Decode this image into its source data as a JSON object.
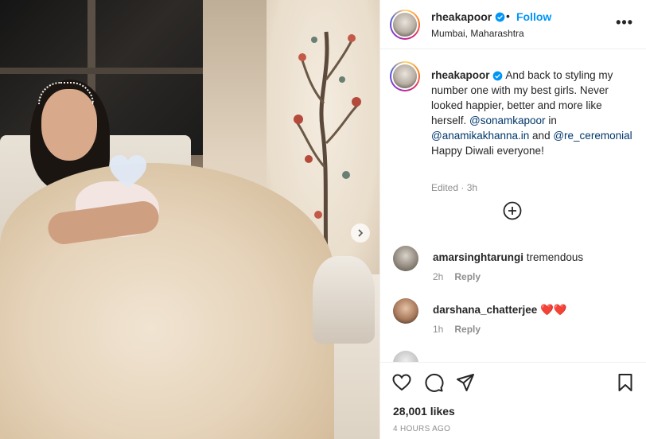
{
  "post": {
    "username": "rheakapoor",
    "location": "Mumbai, Maharashtra",
    "follow_label": "Follow",
    "separator": "•",
    "more_label": "•••"
  },
  "caption": {
    "username": "rheakapoor",
    "text_1": "And back to styling my number one with my best girls. Never looked happier, better and more like herself.",
    "mention_1": "@sonamkapoor",
    "text_2": "in",
    "mention_2": "@anamikakhanna.in",
    "text_3": "and",
    "mention_3": "@re_ceremonial",
    "text_4": "Happy Diwali everyone!",
    "meta": "Edited · 3h"
  },
  "comments": [
    {
      "username": "amarsinghtarungi",
      "text": "tremendous",
      "time": "2h",
      "reply_label": "Reply"
    },
    {
      "username": "darshana_chatterjee",
      "text": "❤️❤️",
      "time": "1h",
      "reply_label": "Reply"
    }
  ],
  "stats": {
    "likes": "28,001 likes",
    "time_ago": "4 HOURS AGO"
  },
  "icons": {
    "heart": "heart-icon",
    "comment": "comment-icon",
    "share": "share-icon",
    "save": "bookmark-icon",
    "more": "more-options-icon",
    "add": "plus-circle-icon",
    "next": "chevron-right-icon",
    "verified": "verified-badge-icon"
  },
  "colors": {
    "accent": "#0095f6",
    "mention": "#00376b",
    "muted": "#8e8e8e",
    "heart_red": "#ed4956"
  }
}
